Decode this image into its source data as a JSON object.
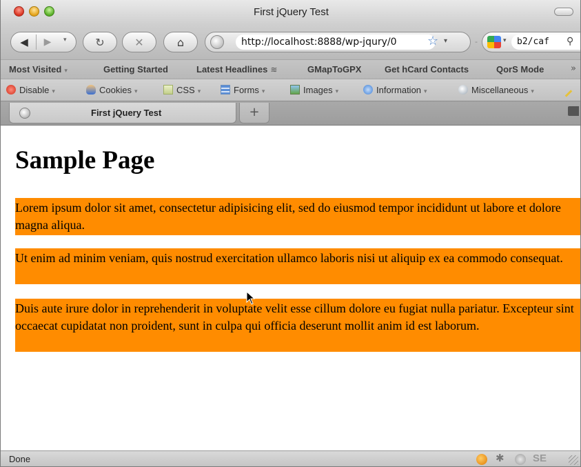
{
  "window": {
    "title": "First jQuery Test"
  },
  "toolbar": {
    "back_glyph": "◀",
    "forward_glyph": "▶",
    "dropdown_glyph": "▾",
    "reload_glyph": "↻",
    "stop_glyph": "✕",
    "home_glyph": "⌂",
    "url": "http://localhost:8888/wp-jqury/0",
    "star_glyph": "☆",
    "search_value": "b2/caf",
    "search_glyph": "⚲",
    "dash": "-"
  },
  "bookmarks": {
    "items": [
      {
        "label": "Most Visited",
        "has_dropdown": true
      },
      {
        "label": "Getting Started"
      },
      {
        "label": "Latest Headlines",
        "feed_icon": "rss-icon",
        "feed_glyph": "≋"
      },
      {
        "label": "GMapToGPX"
      },
      {
        "label": "Get hCard Contacts"
      },
      {
        "label": "QorS Mode"
      }
    ],
    "more_glyph": "»",
    "caret": "▾"
  },
  "devtools": {
    "items": [
      {
        "label": "Disable",
        "icon": "disable-icon"
      },
      {
        "label": "Cookies",
        "icon": "cookies-icon"
      },
      {
        "label": "CSS",
        "icon": "css-icon"
      },
      {
        "label": "Forms",
        "icon": "forms-icon"
      },
      {
        "label": "Images",
        "icon": "images-icon"
      },
      {
        "label": "Information",
        "icon": "information-icon"
      },
      {
        "label": "Miscellaneous",
        "icon": "miscellaneous-icon"
      }
    ],
    "caret": "▾"
  },
  "tabs": [
    {
      "label": "First jQuery Test",
      "active": true
    }
  ],
  "new_tab_glyph": "+",
  "page": {
    "heading": "Sample Page",
    "paragraphs": [
      "Lorem ipsum dolor sit amet, consectetur adipisicing elit, sed do eiusmod tempor incididunt ut labore et dolore magna aliqua.",
      "Ut enim ad minim veniam, quis nostrud exercitation ullamco laboris nisi ut aliquip ex ea commodo consequat.",
      "Duis aute irure dolor in reprehenderit in voluptate velit esse cillum dolore eu fugiat nulla pariatur. Excepteur sint occaecat cupidatat non proident, sunt in culpa qui officia deserunt mollit anim id est laborum."
    ],
    "paragraph_background": "#ff8c00"
  },
  "status": {
    "text": "Done",
    "yslow_glyph": "✱",
    "seo_label": "SE"
  }
}
